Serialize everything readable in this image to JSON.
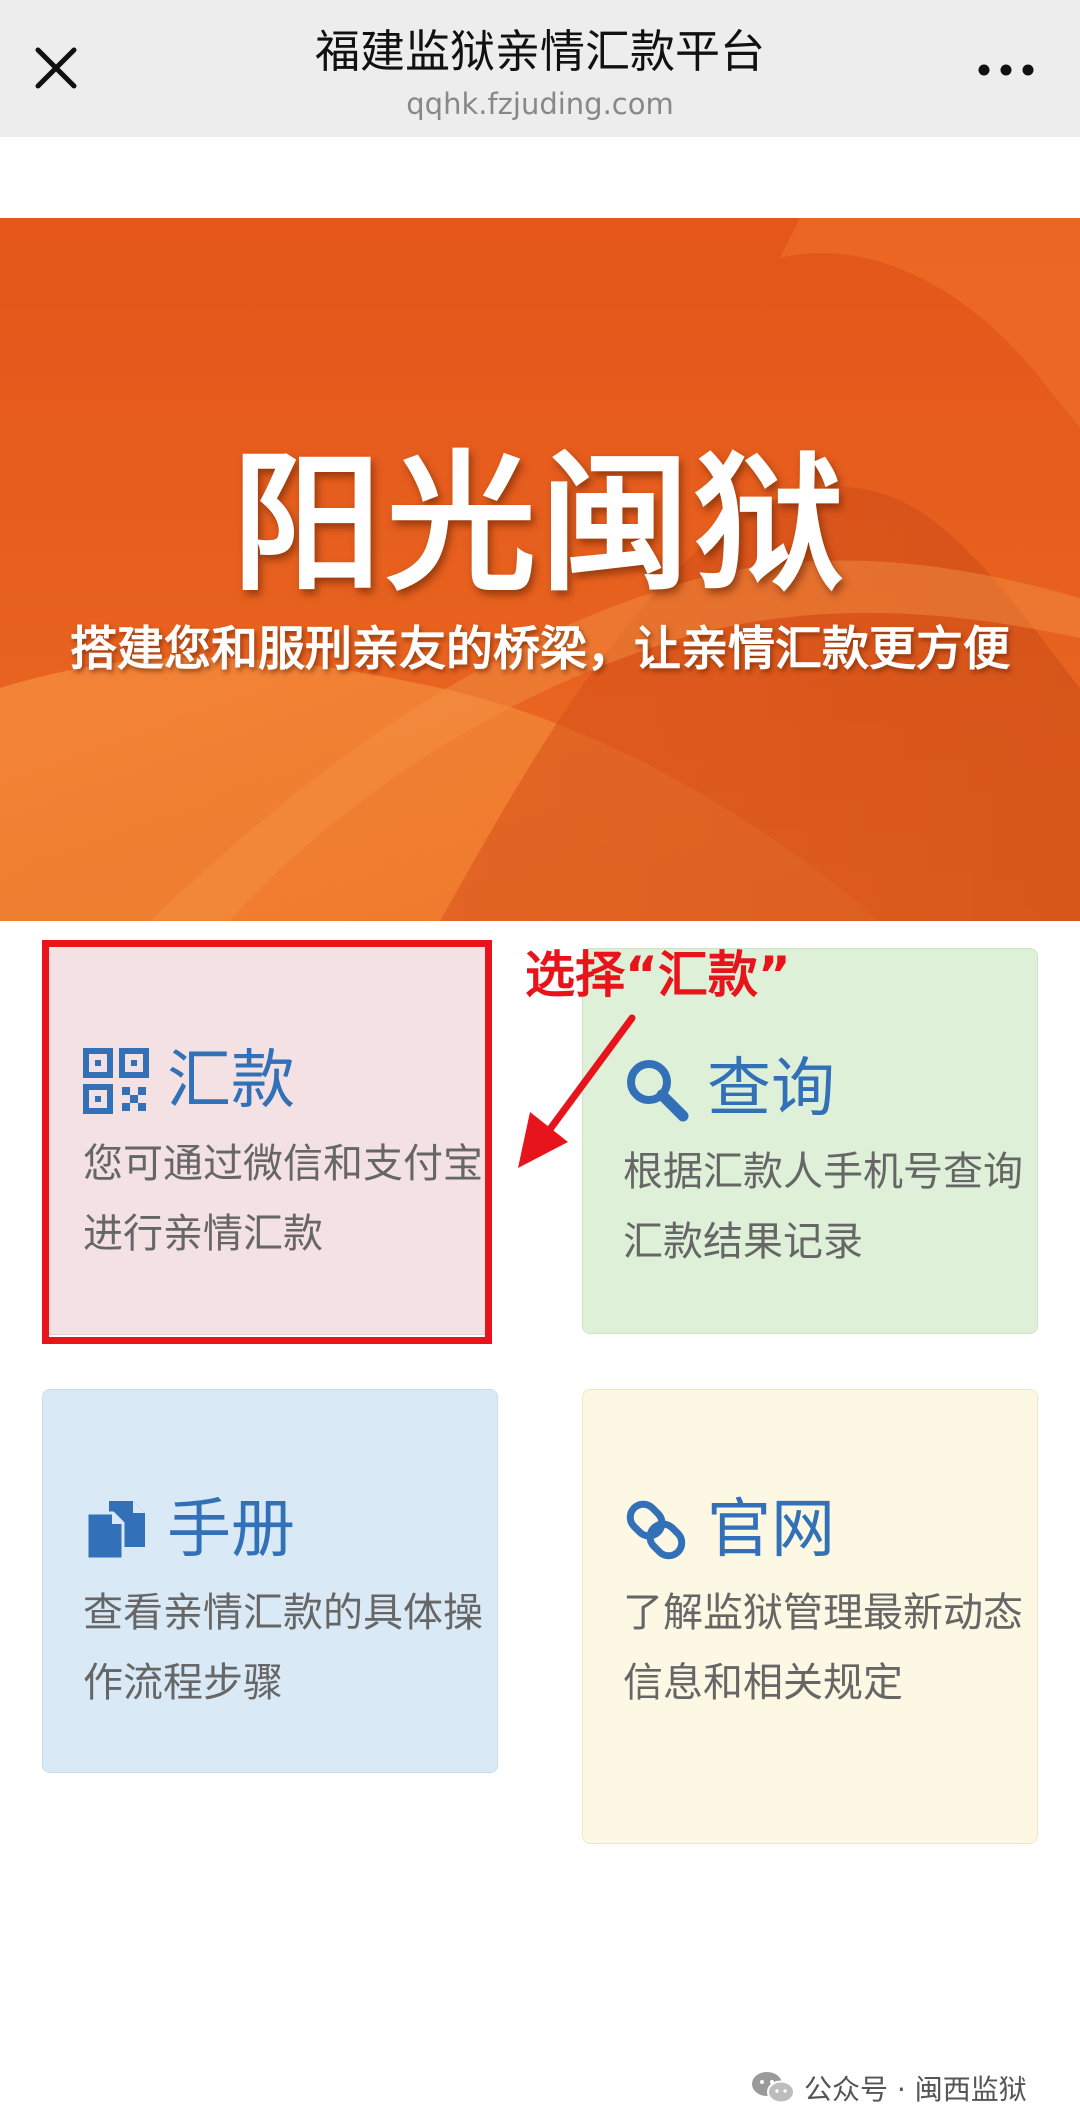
{
  "header": {
    "title": "福建监狱亲情汇款平台",
    "url": "qqhk.fzjuding.com",
    "close_icon": "close-icon",
    "more_icon": "more-dots-icon"
  },
  "banner": {
    "title": "阳光闽狱",
    "subtitle": "搭建您和服刑亲友的桥梁，让亲情汇款更方便",
    "color": "#e8611f"
  },
  "cards": [
    {
      "title": "汇款",
      "description": "您可通过微信和支付宝进行亲情汇款",
      "icon": "qr-code-icon",
      "background": "#f3e1e3"
    },
    {
      "title": "查询",
      "description": "根据汇款人手机号查询汇款结果记录",
      "icon": "search-icon",
      "background": "#dff0d8"
    },
    {
      "title": "手册",
      "description": "查看亲情汇款的具体操作流程步骤",
      "icon": "documents-icon",
      "background": "#d9eaf6"
    },
    {
      "title": "官网",
      "description": "了解监狱管理最新动态信息和相关规定",
      "icon": "link-icon",
      "background": "#fcf8e3"
    }
  ],
  "annotation": {
    "text": "选择“汇款”",
    "color": "#e8141c"
  },
  "footer": {
    "text": "公众号 · 闽西监狱",
    "icon": "wechat-icon"
  },
  "colors": {
    "accent": "#3270b8"
  }
}
